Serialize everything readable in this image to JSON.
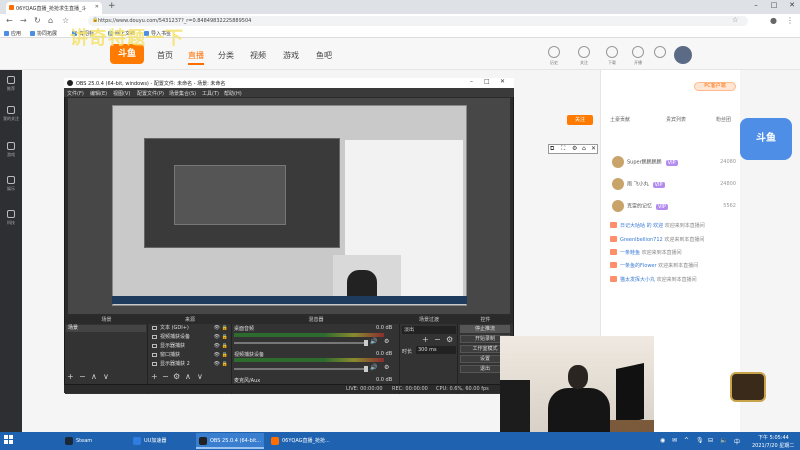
{
  "browser": {
    "tab_title": "06YQAG直播_抢抢求生直播_斗",
    "url": "https://www.douyu.com/5431237?_r=0.84849832225889504",
    "bookmarks": [
      "应用",
      "协同拓展",
      "有招标",
      "网上文档",
      "导入书签"
    ]
  },
  "overlay_title": "讲奇特题一下",
  "site": {
    "logo": "斗鱼",
    "nav": [
      "首页",
      "直播",
      "分类",
      "视频",
      "游戏",
      "鱼吧"
    ],
    "top_labels": [
      "历史",
      "关注",
      "下载",
      "开播",
      "",
      ""
    ],
    "pc_button": "PC客户端",
    "follow_button": "关注",
    "panel_tabs": [
      "土豪贡献",
      "贵宾列表",
      "粉丝团"
    ],
    "mascot": "斗鱼",
    "sidebar": [
      "推荐",
      "我的关注",
      "游戏",
      "娱乐",
      "科技"
    ]
  },
  "ranks": [
    {
      "name": "Super鹏鹏鹏鹏",
      "badge": "VIP",
      "num": "24080"
    },
    {
      "name": "雨 飞小丸",
      "badge": "VIP",
      "num": "24800"
    },
    {
      "name": "克雷的记忆",
      "badge": "VIP",
      "num": "5562"
    }
  ],
  "messages": [
    {
      "user": "日记大咕咕 的 欢迎",
      "text": " 欢迎来到本直播间"
    },
    {
      "user": "Greenlbellion712",
      "text": " 欢迎来到本直播间"
    },
    {
      "user": "一条鲑鱼",
      "text": " 欢迎来到本直播间"
    },
    {
      "user": "一条鱼的Flower",
      "text": " 欢迎来到本直播间"
    },
    {
      "user": "猫太发挥大小丸",
      "text": " 欢迎来到本直播间"
    }
  ],
  "obs": {
    "title": "OBS 25.0.4 (64-bit, windows) - 配置文件: 未命名 - 场景: 未命名",
    "menu": [
      "文件(F)",
      "编辑(E)",
      "视图(V)",
      "配置文件(P)",
      "场景集合(S)",
      "工具(T)",
      "帮助(H)"
    ],
    "docks": {
      "scenes": "场景",
      "sources": "来源",
      "mixer": "混音器",
      "transitions": "场景过渡",
      "controls": "控件"
    },
    "scene_item": "场景",
    "sources": [
      "文本 (GDI+)",
      "视频捕获设备",
      "显示器捕获",
      "窗口捕获",
      "显示器捕获 2"
    ],
    "mixer": [
      {
        "label": "桌面音频",
        "db": "0.0 dB"
      },
      {
        "label": "视频捕获设备",
        "db": "0.0 dB"
      },
      {
        "label": "麦克风/Aux",
        "db": "0.0 dB"
      }
    ],
    "transition": "淡出",
    "duration_label": "时长",
    "duration_value": "300 ms",
    "controls": [
      "停止推流",
      "开始录制",
      "工作室模式",
      "设置",
      "退出"
    ],
    "status": {
      "live": "LIVE: 00:00:00",
      "rec": "REC: 00:00:00",
      "cpu": "CPU: 0.6%, 60.00 fps"
    }
  },
  "taskbar": {
    "items": [
      {
        "label": "Steam",
        "color": "#1b2838"
      },
      {
        "label": "UU加速器",
        "color": "#2f7de1"
      },
      {
        "label": "OBS 25.0.4 (64-bit...",
        "color": "#222222"
      },
      {
        "label": "06YQAG直播_抢抢...",
        "color": "#ff6d00"
      }
    ],
    "time": "下午 5:05:44",
    "date": "2021/7/20 星期二"
  },
  "colors": {
    "accent": "#ff6d00",
    "taskbar": "#1f63b0",
    "obs_bg": "#2b2b2b"
  }
}
